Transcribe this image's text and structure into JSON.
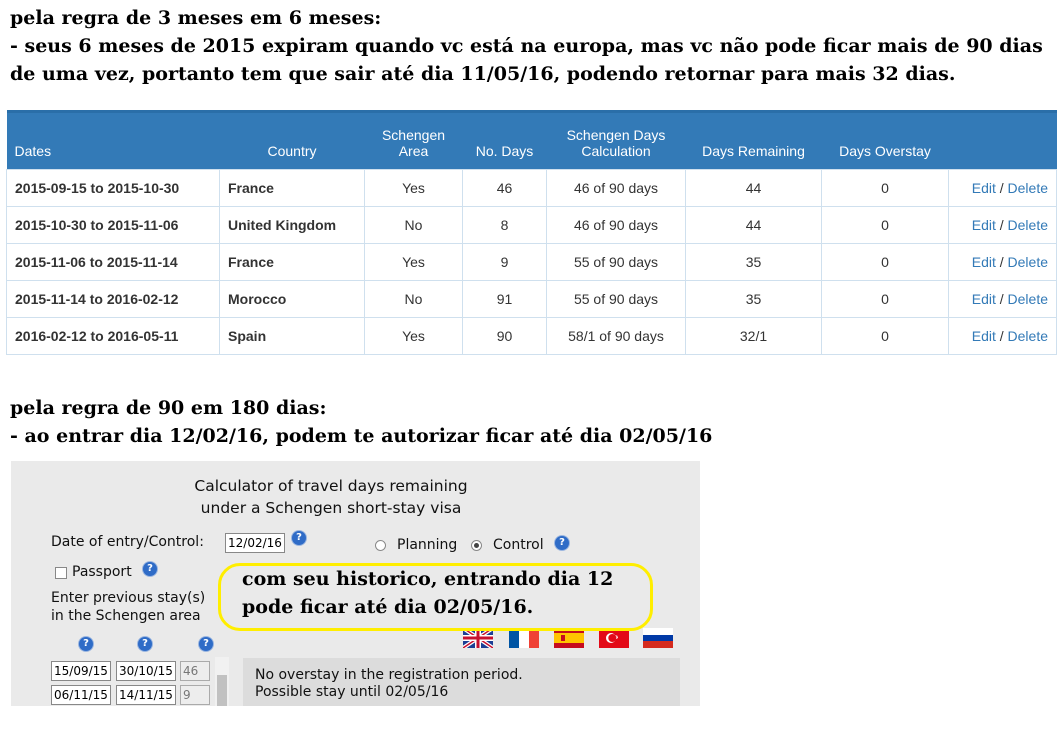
{
  "note1": {
    "line1": "pela regra de 3 meses em 6 meses:",
    "line2": "- seus 6 meses de 2015 expiram quando vc está na europa, mas vc não pode ficar mais de 90 dias",
    "line3": "de uma vez, portanto tem que sair até dia 11/05/16, podendo retornar para mais 32 dias."
  },
  "table": {
    "headers": {
      "dates": "Dates",
      "country": "Country",
      "schengen_area_1": "Schengen",
      "schengen_area_2": "Area",
      "no_days": "No. Days",
      "calc_1": "Schengen Days",
      "calc_2": "Calculation",
      "remaining": "Days Remaining",
      "overstay": "Days Overstay"
    },
    "rows": [
      {
        "dates": "2015-09-15 to 2015-10-30",
        "country": "France",
        "schengen": "Yes",
        "days": "46",
        "calc": "46 of 90 days",
        "remaining": "44",
        "overstay": "0",
        "edit": "Edit",
        "delete": "Delete"
      },
      {
        "dates": "2015-10-30 to 2015-11-06",
        "country": "United Kingdom",
        "schengen": "No",
        "days": "8",
        "calc": "46 of 90 days",
        "remaining": "44",
        "overstay": "0",
        "edit": "Edit",
        "delete": "Delete"
      },
      {
        "dates": "2015-11-06 to 2015-11-14",
        "country": "France",
        "schengen": "Yes",
        "days": "9",
        "calc": "55 of 90 days",
        "remaining": "35",
        "overstay": "0",
        "edit": "Edit",
        "delete": "Delete"
      },
      {
        "dates": "2015-11-14 to 2016-02-12",
        "country": "Morocco",
        "schengen": "No",
        "days": "91",
        "calc": "55 of 90 days",
        "remaining": "35",
        "overstay": "0",
        "edit": "Edit",
        "delete": "Delete"
      },
      {
        "dates": "2016-02-12 to 2016-05-11",
        "country": "Spain",
        "schengen": "Yes",
        "days": "90",
        "calc": "58/1 of 90 days",
        "remaining": "32/1",
        "overstay": "0",
        "edit": "Edit",
        "delete": "Delete"
      }
    ],
    "action_separator": "/"
  },
  "note2": {
    "line1": "pela regra de 90 em 180 dias:",
    "line2": "- ao entrar dia 12/02/16, podem te autorizar ficar até dia 02/05/16"
  },
  "calculator": {
    "title_1": "Calculator of travel days remaining",
    "title_2": "under a Schengen short-stay visa",
    "entry_label": "Date of entry/Control:",
    "entry_value": "12/02/16",
    "mode_planning": "Planning",
    "mode_control": "Control",
    "selected_mode": "Control",
    "passport_label": "Passport",
    "prev_label_1": "Enter previous stay(s)",
    "prev_label_2": "in the Schengen area",
    "help_glyph": "?",
    "stays": [
      {
        "from": "15/09/15",
        "to": "30/10/15",
        "days": "46"
      },
      {
        "from": "06/11/15",
        "to": "14/11/15",
        "days": "9"
      }
    ],
    "result_1": "No overstay in the registration period.",
    "result_2": "Possible stay until 02/05/16",
    "flags": [
      "uk-flag-icon",
      "france-flag-icon",
      "spain-flag-icon",
      "turkey-flag-icon",
      "russia-flag-icon"
    ]
  },
  "callout": {
    "line1": "com seu historico, entrando dia 12",
    "line2": "pode ficar até dia 02/05/16.",
    "color": "#ffee00"
  },
  "colors": {
    "table_header": "#337ab7",
    "link": "#337ab7"
  }
}
